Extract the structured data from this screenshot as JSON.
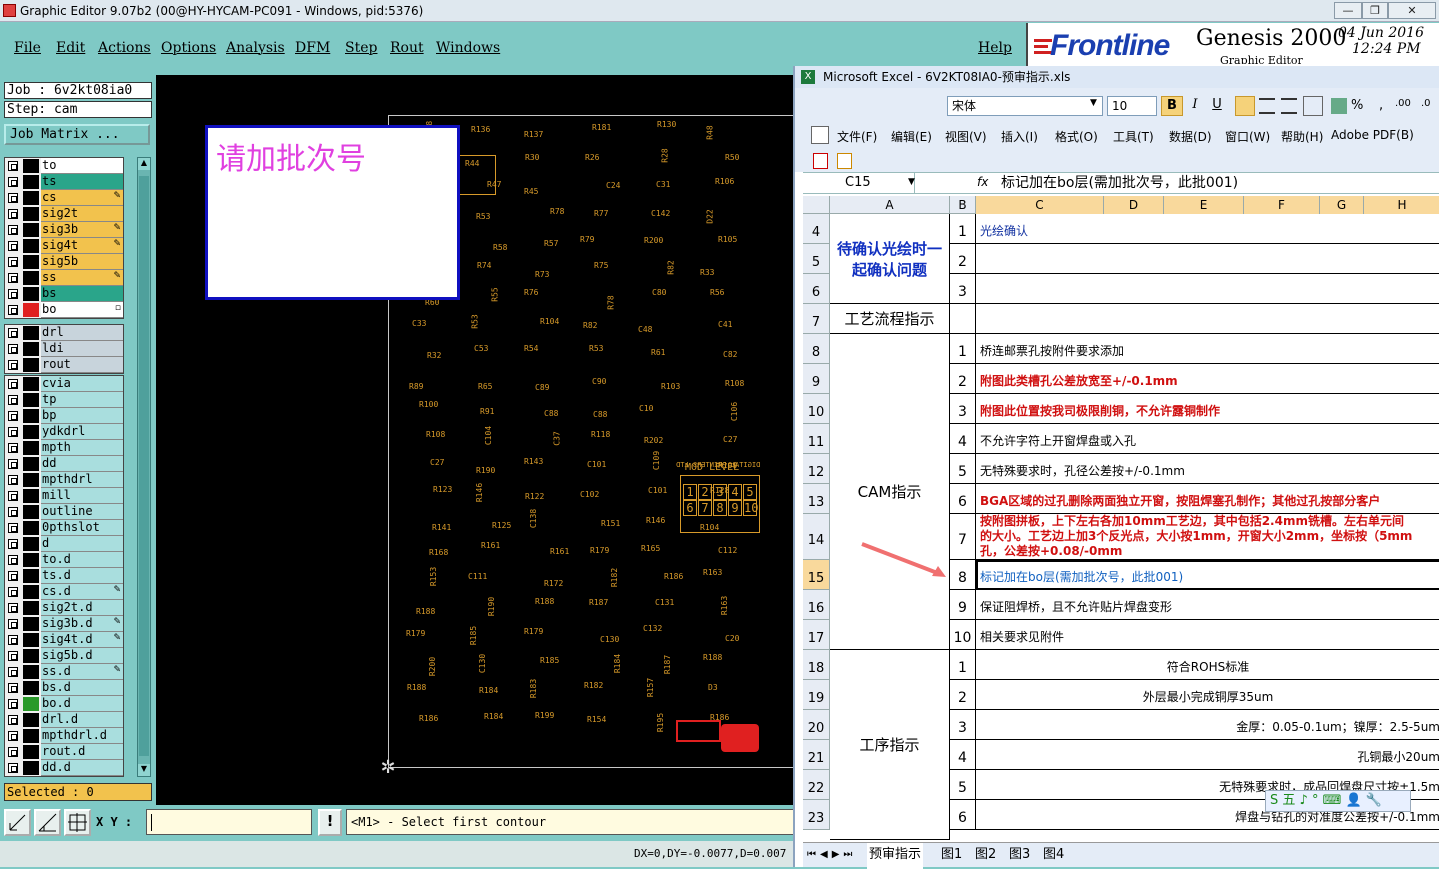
{
  "window": {
    "title": "Graphic Editor 9.07b2 (00@HY-HYCAM-PC091 - Windows, pid:5376)",
    "min": "—",
    "max": "❐",
    "close": "✕"
  },
  "menu": {
    "items": [
      "File",
      "Edit",
      "Actions",
      "Options",
      "Analysis",
      "DFM",
      "Step",
      "Rout",
      "Windows"
    ],
    "help": "Help"
  },
  "brand": {
    "logo": "Frontline",
    "product": "Genesis 2000",
    "subtitle": "Graphic Editor",
    "date": "04 Jun 2016",
    "time": "12:24 PM"
  },
  "job": {
    "job_line": "Job : 6v2kt08ia0",
    "step_line": "Step: cam",
    "matrix": "Job Matrix ..."
  },
  "layers_top": [
    {
      "name": "to",
      "color": "#ffffff",
      "mark": ""
    },
    {
      "name": "ts",
      "color": "#2aa58a",
      "mark": ""
    },
    {
      "name": "cs",
      "color": "#f2c24d",
      "mark": "✎"
    },
    {
      "name": "sig2t",
      "color": "#f2c24d",
      "mark": ""
    },
    {
      "name": "sig3b",
      "color": "#f2c24d",
      "mark": "✎"
    },
    {
      "name": "sig4t",
      "color": "#f2c24d",
      "mark": "✎"
    },
    {
      "name": "sig5b",
      "color": "#f2c24d",
      "mark": ""
    },
    {
      "name": "ss",
      "color": "#f2c24d",
      "mark": "✎"
    },
    {
      "name": "bs",
      "color": "#2aa58a",
      "mark": ""
    },
    {
      "name": "bo",
      "color": "#ffffff",
      "mark": "▫"
    }
  ],
  "layers_drill": [
    {
      "name": "drl"
    },
    {
      "name": "ldi"
    },
    {
      "name": "rout"
    }
  ],
  "layers_misc": [
    {
      "name": "cvia",
      "mark": ""
    },
    {
      "name": "tp",
      "mark": ""
    },
    {
      "name": "bp",
      "mark": ""
    },
    {
      "name": "ydkdrl",
      "mark": ""
    },
    {
      "name": "mpth",
      "mark": ""
    },
    {
      "name": "dd",
      "mark": ""
    },
    {
      "name": "mpthdrl",
      "mark": ""
    },
    {
      "name": "mill",
      "mark": ""
    },
    {
      "name": "outline",
      "mark": ""
    },
    {
      "name": "0pthslot",
      "mark": ""
    },
    {
      "name": "d",
      "mark": ""
    },
    {
      "name": "to.d",
      "mark": ""
    },
    {
      "name": "ts.d",
      "mark": ""
    },
    {
      "name": "cs.d",
      "mark": "✎"
    },
    {
      "name": "sig2t.d",
      "mark": ""
    },
    {
      "name": "sig3b.d",
      "mark": "✎"
    },
    {
      "name": "sig4t.d",
      "mark": "✎"
    },
    {
      "name": "sig5b.d",
      "mark": ""
    },
    {
      "name": "ss.d",
      "mark": "✎"
    },
    {
      "name": "bs.d",
      "mark": ""
    },
    {
      "name": "bo.d",
      "mark": ""
    },
    {
      "name": "drl.d",
      "mark": ""
    },
    {
      "name": "mpthdrl.d",
      "mark": ""
    },
    {
      "name": "rout.d",
      "mark": ""
    },
    {
      "name": "dd.d",
      "mark": ""
    }
  ],
  "selected": "Selected : 0",
  "popup_text": "请加批次号",
  "board": {
    "labels": [
      "R138",
      "R136",
      "R137",
      "R181",
      "R130",
      "R48",
      "R46",
      "R44",
      "R30",
      "R26",
      "R28",
      "R50",
      "R54",
      "R47",
      "R45",
      "C24",
      "C31",
      "R106",
      "R52",
      "R53",
      "R78",
      "R77",
      "C142",
      "D22",
      "D16",
      "R58",
      "R57",
      "R79",
      "R200",
      "R105",
      "C144",
      "R74",
      "R73",
      "R75",
      "R82",
      "R33",
      "R60",
      "R55",
      "R76",
      "R78",
      "C80",
      "R56",
      "C33",
      "R53",
      "R104",
      "R82",
      "C48",
      "C41",
      "R32",
      "C53",
      "R54",
      "R53",
      "R61",
      "C82",
      "R89",
      "R65",
      "C89",
      "C90",
      "R103",
      "R108",
      "R100",
      "R91",
      "C88",
      "C88",
      "C10",
      "C106",
      "R108",
      "C104",
      "C37",
      "R118",
      "R202",
      "C27",
      "C27",
      "R190",
      "R143",
      "C101",
      "C109",
      "R109",
      "R123",
      "R146",
      "R122",
      "C102",
      "C101",
      "R128",
      "R141",
      "R125",
      "C138",
      "R151",
      "R146",
      "R104",
      "R168",
      "R161",
      "R161",
      "R179",
      "R165",
      "C112",
      "R153",
      "C111",
      "R172",
      "R182",
      "R186",
      "R163",
      "R188",
      "R190",
      "R188",
      "R187",
      "C131",
      "R163",
      "R179",
      "R185",
      "R179",
      "C130",
      "C132",
      "C20",
      "R200",
      "C130",
      "R185",
      "R184",
      "R187",
      "R188",
      "R188",
      "R184",
      "R183",
      "R182",
      "R157",
      "D3",
      "R186",
      "R184",
      "R199",
      "R154",
      "R195",
      "R186"
    ],
    "mod_label": "MOD LEVEL",
    "mod_digits": [
      "1",
      "2",
      "3",
      "4",
      "5",
      "6",
      "7",
      "8",
      "9",
      "10"
    ],
    "printer": "DIGITAL PRINTERS LTD"
  },
  "bottom": {
    "xy_label": "X Y :",
    "status": "<M1> - Select first contour",
    "coords": "DX=0,DY=-0.0077,D=0.007"
  },
  "excel": {
    "title": "Microsoft Excel - 6V2KT08IA0-预审指示.xls",
    "font_name": "宋体",
    "font_size": "10",
    "format_buttons": [
      "B",
      "I",
      "U"
    ],
    "menu": [
      "文件(F)",
      "编辑(E)",
      "视图(V)",
      "插入(I)",
      "格式(O)",
      "工具(T)",
      "数据(D)",
      "窗口(W)",
      "帮助(H)",
      "Adobe PDF(B)"
    ],
    "cell_ref": "C15",
    "fx": "fx",
    "formula": "标记加在bo层(需加批次号，此批001)",
    "columns": [
      "A",
      "B",
      "C",
      "D",
      "E",
      "F",
      "G",
      "H"
    ],
    "sections": [
      {
        "label": "待确认光绘时一起确认问题",
        "rows": [
          "4",
          "5",
          "6"
        ]
      },
      {
        "label": "工艺流程指示",
        "rows": [
          "7"
        ]
      },
      {
        "label": "CAM指示",
        "rows": [
          "8",
          "9",
          "10",
          "11",
          "12",
          "13",
          "14",
          "15",
          "16",
          "17"
        ]
      },
      {
        "label": "工序指示",
        "rows": [
          "18",
          "19",
          "20",
          "21",
          "22",
          "23"
        ]
      }
    ],
    "rows": [
      {
        "num": "4",
        "idx": "1",
        "text": "光绘确认",
        "color": "#1030a0"
      },
      {
        "num": "5",
        "idx": "2",
        "text": "",
        "color": "#000"
      },
      {
        "num": "6",
        "idx": "3",
        "text": "",
        "color": "#000"
      },
      {
        "num": "7",
        "idx": "",
        "text": "",
        "color": "#000"
      },
      {
        "num": "8",
        "idx": "1",
        "text": "桥连邮票孔按附件要求添加",
        "color": "#000"
      },
      {
        "num": "9",
        "idx": "2",
        "text": "附图此类槽孔公差放宽至+/-0.1mm",
        "color": "#d01010"
      },
      {
        "num": "10",
        "idx": "3",
        "text": "附图此位置按我司极限削铜，不允许露铜制作",
        "color": "#d01010"
      },
      {
        "num": "11",
        "idx": "4",
        "text": "不允许字符上开窗焊盘或入孔",
        "color": "#000"
      },
      {
        "num": "12",
        "idx": "5",
        "text": "无特殊要求时，孔径公差按+/-0.1mm",
        "color": "#000"
      },
      {
        "num": "13",
        "idx": "6",
        "text": "BGA区域的过孔删除两面独立开窗，按阻焊塞孔制作；其他过孔按部分客户",
        "color": "#d01010"
      },
      {
        "num": "14",
        "idx": "7",
        "text": "按附图拼板，上下左右各加10mm工艺边，其中包括2.4mm铣槽。左右单元间",
        "text2": "的大小。工艺边上加3个反光点，大小按1mm，开窗大小2mm，坐标按（5mm",
        "text3": "孔，公差按+0.08/-0mm",
        "color": "#d01010"
      },
      {
        "num": "15",
        "idx": "8",
        "text": "标记加在bo层(需加批次号，此批001)",
        "color": "#1060c0"
      },
      {
        "num": "16",
        "idx": "9",
        "text": "保证阻焊桥，且不允许贴片焊盘变形",
        "color": "#000"
      },
      {
        "num": "17",
        "idx": "10",
        "text": "相关要求见附件",
        "color": "#000"
      },
      {
        "num": "18",
        "idx": "1",
        "text": "符合ROHS标准",
        "color": "#000"
      },
      {
        "num": "19",
        "idx": "2",
        "text": "外层最小完成铜厚35um",
        "color": "#000"
      },
      {
        "num": "20",
        "idx": "3",
        "text": "金厚：0.05-0.1um；镍厚：2.5-5um",
        "color": "#000"
      },
      {
        "num": "21",
        "idx": "4",
        "text": "孔铜最小20um",
        "color": "#000"
      },
      {
        "num": "22",
        "idx": "5",
        "text": "无特殊要求时，成品回焊盘尺寸按±1.5m",
        "color": "#000"
      },
      {
        "num": "23",
        "idx": "6",
        "text": "焊盘与钻孔的对准度公差按+/-0.1mm",
        "color": "#000"
      }
    ],
    "tabs": [
      "预审指示",
      "图1",
      "图2",
      "图3",
      "图4"
    ],
    "ime": "S 五 ♪ ° ⌨ 👤 🔧"
  }
}
